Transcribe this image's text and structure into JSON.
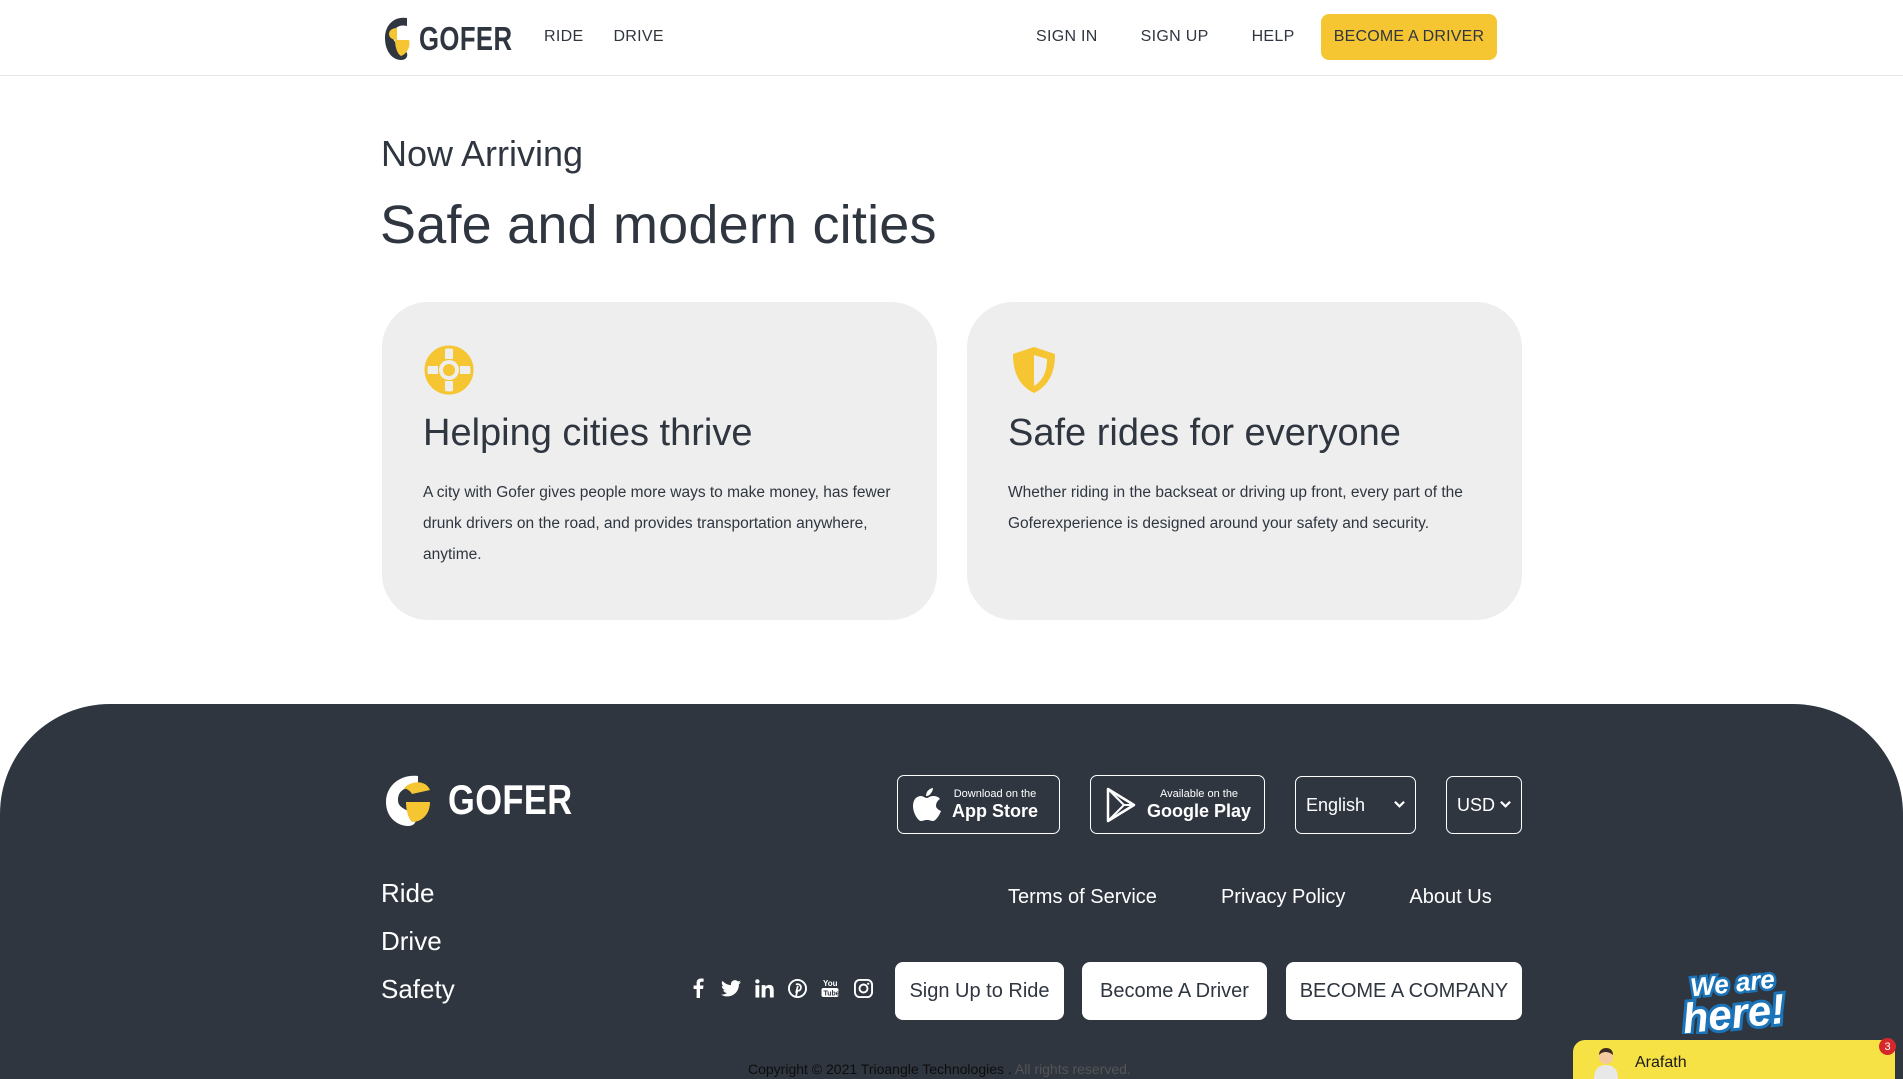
{
  "header": {
    "logo_text": "GOFER",
    "nav_left": [
      "RIDE",
      "DRIVE"
    ],
    "nav_right": [
      "SIGN IN",
      "SIGN UP",
      "HELP"
    ],
    "cta_label": "BECOME A DRIVER"
  },
  "hero": {
    "eyebrow": "Now Arriving",
    "headline": "Safe and modern cities"
  },
  "cards": [
    {
      "icon": "lifebuoy-icon",
      "title": "Helping cities thrive",
      "body": "A city with Gofer gives people more ways to make money, has fewer drunk drivers on the road, and provides transportation anywhere, anytime."
    },
    {
      "icon": "shield-icon",
      "title": "Safe rides for everyone",
      "body": "Whether riding in the backseat or driving up front, every part of the Goferexperience is designed around your safety and security."
    }
  ],
  "footer": {
    "logo_text": "GOFER",
    "app_store": {
      "small": "Download on the",
      "big": "App Store"
    },
    "google_play": {
      "small": "Available on the",
      "big": "Google Play"
    },
    "language": "English",
    "currency": "USD",
    "nav": [
      "Ride",
      "Drive",
      "Safety"
    ],
    "links": [
      "Terms of Service",
      "Privacy Policy",
      "About Us"
    ],
    "social_icons": [
      "facebook-icon",
      "twitter-icon",
      "linkedin-icon",
      "pinterest-icon",
      "youtube-icon",
      "instagram-icon"
    ],
    "cta_buttons": [
      "Sign Up to Ride",
      "Become A Driver",
      "BECOME A COMPANY"
    ],
    "copyright": "Copyright © 2021 Trioangle Technologies .",
    "rights": "All rights reserved."
  },
  "chat": {
    "banner_text": "We are here!",
    "agent_name": "Arafath",
    "unread_count": "3"
  },
  "colors": {
    "accent": "#f6c532",
    "dark": "#2f3640",
    "card_bg": "#eeeeee",
    "chat_bar": "#f6e244"
  }
}
